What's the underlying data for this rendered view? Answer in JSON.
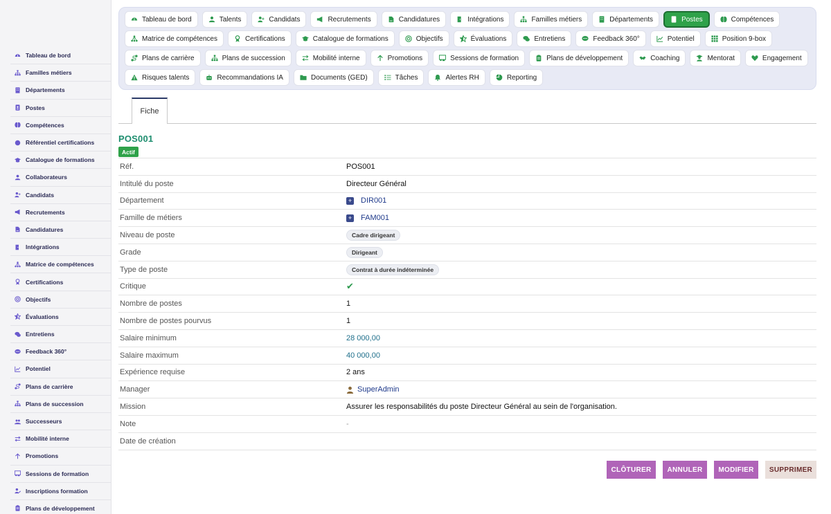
{
  "sidebar": {
    "items": [
      {
        "label": "Tableau de bord",
        "icon": "dashboard-icon"
      },
      {
        "label": "Familles métiers",
        "icon": "sitemap-icon"
      },
      {
        "label": "Départements",
        "icon": "building-icon"
      },
      {
        "label": "Postes",
        "icon": "id-badge-icon"
      },
      {
        "label": "Compétences",
        "icon": "brain-icon"
      },
      {
        "label": "Référentiel certifications",
        "icon": "certificate-icon"
      },
      {
        "label": "Catalogue de formations",
        "icon": "graduation-cap-icon"
      },
      {
        "label": "Collaborateurs",
        "icon": "user-icon"
      },
      {
        "label": "Candidats",
        "icon": "user-plus-icon"
      },
      {
        "label": "Recrutements",
        "icon": "bullhorn-icon"
      },
      {
        "label": "Candidatures",
        "icon": "file-signature-icon"
      },
      {
        "label": "Intégrations",
        "icon": "door-open-icon"
      },
      {
        "label": "Matrice de compétences",
        "icon": "network-icon"
      },
      {
        "label": "Certifications",
        "icon": "award-icon"
      },
      {
        "label": "Objectifs",
        "icon": "target-icon"
      },
      {
        "label": "Évaluations",
        "icon": "star-half-icon"
      },
      {
        "label": "Entretiens",
        "icon": "comments-icon"
      },
      {
        "label": "Feedback 360°",
        "icon": "comment-dots-icon"
      },
      {
        "label": "Potentiel",
        "icon": "chart-line-icon"
      },
      {
        "label": "Plans de carrière",
        "icon": "route-icon"
      },
      {
        "label": "Plans de succession",
        "icon": "sitemap-icon"
      },
      {
        "label": "Successeurs",
        "icon": "users-icon"
      },
      {
        "label": "Mobilité interne",
        "icon": "exchange-icon"
      },
      {
        "label": "Promotions",
        "icon": "arrow-up-icon"
      },
      {
        "label": "Sessions de formation",
        "icon": "chalkboard-icon"
      },
      {
        "label": "Inscriptions formation",
        "icon": "user-edit-icon"
      },
      {
        "label": "Plans de développement",
        "icon": "clipboard-icon"
      }
    ]
  },
  "tabs": {
    "rows": [
      [
        {
          "label": "Tableau de bord",
          "icon": "dashboard-icon"
        },
        {
          "label": "Talents",
          "icon": "user-tie-icon"
        },
        {
          "label": "Candidats",
          "icon": "user-plus-icon"
        },
        {
          "label": "Recrutements",
          "icon": "bullhorn-icon"
        },
        {
          "label": "Candidatures",
          "icon": "file-signature-icon"
        },
        {
          "label": "Intégrations",
          "icon": "door-open-icon"
        },
        {
          "label": "Familles métiers",
          "icon": "sitemap-icon"
        },
        {
          "label": "Départements",
          "icon": "building-icon"
        },
        {
          "label": "Postes",
          "icon": "id-badge-icon",
          "active": true
        },
        {
          "label": "Compétences",
          "icon": "brain-icon"
        }
      ],
      [
        {
          "label": "Matrice de compétences",
          "icon": "network-icon"
        },
        {
          "label": "Certifications",
          "icon": "award-icon"
        },
        {
          "label": "Catalogue de formations",
          "icon": "graduation-cap-icon"
        },
        {
          "label": "Objectifs",
          "icon": "target-icon"
        },
        {
          "label": "Évaluations",
          "icon": "star-half-icon"
        },
        {
          "label": "Entretiens",
          "icon": "comments-icon"
        },
        {
          "label": "Feedback 360°",
          "icon": "comment-dots-icon"
        },
        {
          "label": "Potentiel",
          "icon": "chart-line-icon"
        },
        {
          "label": "Position 9-box",
          "icon": "grid-icon"
        }
      ],
      [
        {
          "label": "Plans de carrière",
          "icon": "route-icon"
        },
        {
          "label": "Plans de succession",
          "icon": "sitemap-icon"
        },
        {
          "label": "Mobilité interne",
          "icon": "exchange-icon"
        },
        {
          "label": "Promotions",
          "icon": "arrow-up-icon"
        },
        {
          "label": "Sessions de formation",
          "icon": "chalkboard-icon"
        },
        {
          "label": "Plans de développement",
          "icon": "clipboard-icon"
        },
        {
          "label": "Coaching",
          "icon": "handshake-icon"
        },
        {
          "label": "Mentorat",
          "icon": "user-graduate-icon"
        },
        {
          "label": "Engagement",
          "icon": "heart-icon"
        }
      ],
      [
        {
          "label": "Risques talents",
          "icon": "warning-icon"
        },
        {
          "label": "Recommandations IA",
          "icon": "robot-icon"
        },
        {
          "label": "Documents (GED)",
          "icon": "folder-icon"
        },
        {
          "label": "Tâches",
          "icon": "tasks-icon"
        },
        {
          "label": "Alertes RH",
          "icon": "bell-icon"
        },
        {
          "label": "Reporting",
          "icon": "pie-chart-icon"
        }
      ]
    ]
  },
  "record": {
    "tab_label": "Fiche",
    "code": "POS001",
    "status": "Actif",
    "fields": {
      "ref": {
        "label": "Réf.",
        "value": "POS001"
      },
      "title": {
        "label": "Intitulé du poste",
        "value": "Directeur Général"
      },
      "department": {
        "label": "Département",
        "value": "DIR001"
      },
      "family": {
        "label": "Famille de métiers",
        "value": "FAM001"
      },
      "level": {
        "label": "Niveau de poste",
        "value": "Cadre dirigeant"
      },
      "grade": {
        "label": "Grade",
        "value": "Dirigeant"
      },
      "type": {
        "label": "Type de poste",
        "value": "Contrat à durée indéterminée"
      },
      "critical": {
        "label": "Critique",
        "value": "✔"
      },
      "positions": {
        "label": "Nombre de postes",
        "value": "1"
      },
      "filled": {
        "label": "Nombre de postes pourvus",
        "value": "1"
      },
      "salary_min": {
        "label": "Salaire minimum",
        "value": "28 000,00"
      },
      "salary_max": {
        "label": "Salaire maximum",
        "value": "40 000,00"
      },
      "experience": {
        "label": "Expérience requise",
        "value": "2 ans"
      },
      "manager": {
        "label": "Manager",
        "value": "SuperAdmin"
      },
      "mission": {
        "label": "Mission",
        "value": "Assurer les responsabilités du poste Directeur Général au sein de l'organisation."
      },
      "note": {
        "label": "Note",
        "value": "-"
      },
      "created": {
        "label": "Date de création",
        "value": ""
      }
    }
  },
  "actions": {
    "close": "CLÔTURER",
    "cancel": "ANNULER",
    "edit": "MODIFIER",
    "delete": "SUPPRIMER"
  },
  "colors": {
    "accent_green": "#2fa24a",
    "action_purple": "#b064b8",
    "code_teal": "#1e8e6f"
  }
}
